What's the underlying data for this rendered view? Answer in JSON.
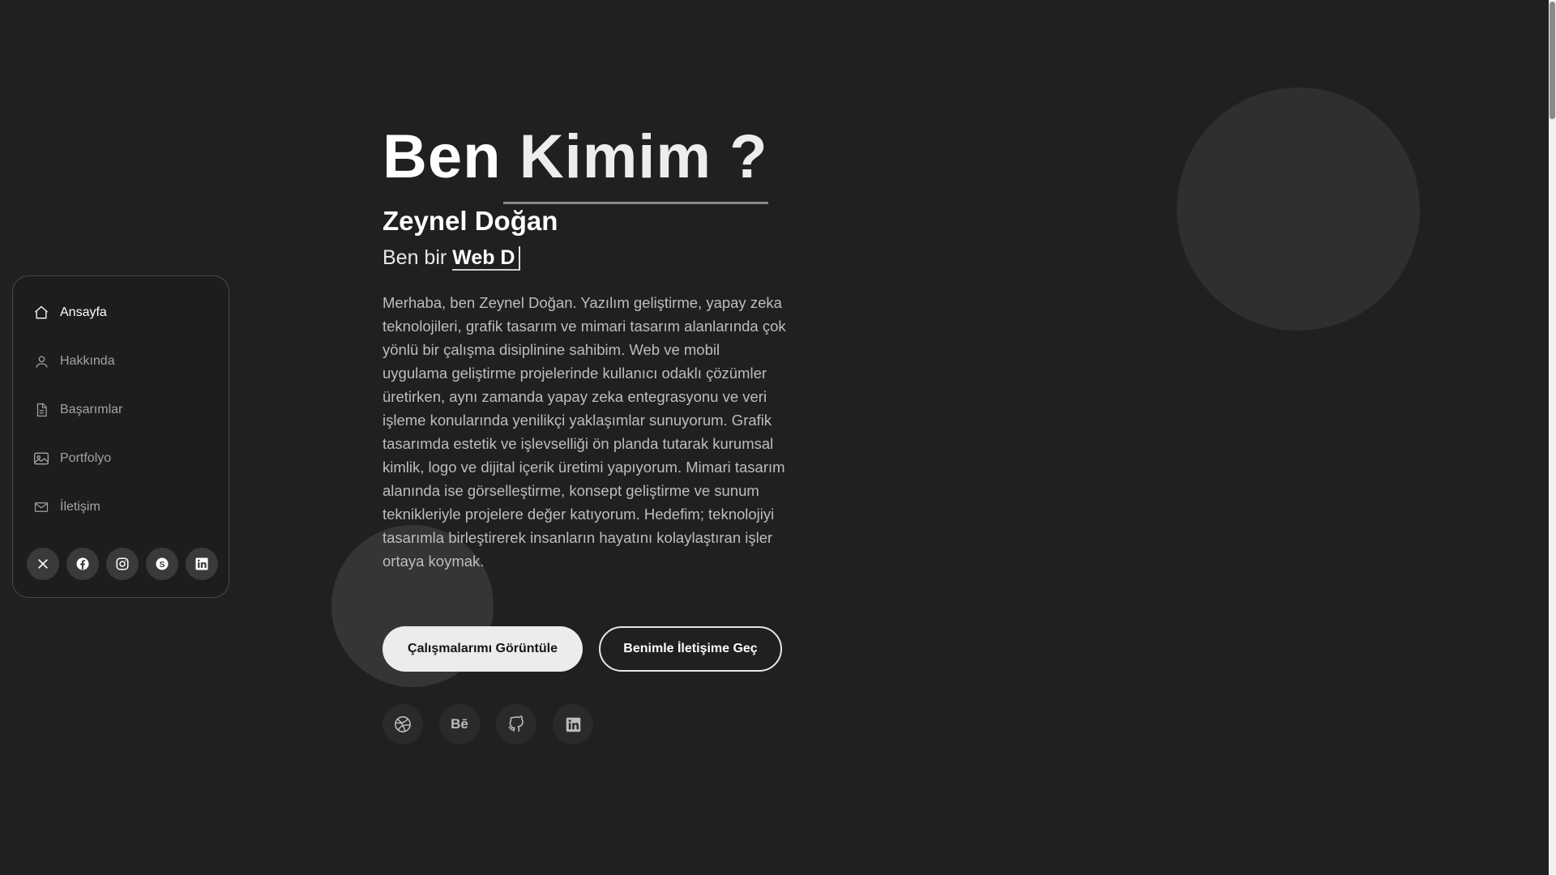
{
  "sidebar": {
    "items": [
      {
        "label": "Ansayfa",
        "icon": "home-icon",
        "active": true
      },
      {
        "label": "Hakkında",
        "icon": "user-icon"
      },
      {
        "label": "Başarımlar",
        "icon": "document-icon"
      },
      {
        "label": "Portfolyo",
        "icon": "images-icon"
      },
      {
        "label": "İletişim",
        "icon": "mail-icon"
      }
    ],
    "socials": [
      "x-icon",
      "facebook-icon",
      "instagram-icon",
      "skype-icon",
      "linkedin-icon"
    ]
  },
  "hero": {
    "title_a": "Ben",
    "title_b": "Kimim ?",
    "name": "Zeynel Doğan",
    "role_prefix": "Ben bir",
    "role_typed": "Web D",
    "description": "Merhaba, ben Zeynel Doğan. Yazılım geliştirme, yapay zeka teknolojileri, grafik tasarım ve mimari tasarım alanlarında çok yönlü bir çalışma disiplinine sahibim. Web ve mobil uygulama geliştirme projelerinde kullanıcı odaklı çözümler üretirken, aynı zamanda yapay zeka entegrasyonu ve veri işleme konularında yenilikçi yaklaşımlar sunuyorum. Grafik tasarımda estetik ve işlevselliği ön planda tutarak kurumsal kimlik, logo ve dijital içerik üretimi yapıyorum. Mimari tasarım alanında ise görselleştirme, konsept geliştirme ve sunum teknikleriyle projelere değer katıyorum. Hedefim; teknolojiyi tasarımla birleştirerek insanların hayatını kolaylaştıran işler ortaya koymak.",
    "primary_button": "Çalışmalarımı Görüntüle",
    "secondary_button": "Benimle İletişime Geç",
    "socials": [
      "dribbble-icon",
      "behance-icon",
      "github-icon",
      "linkedin-icon"
    ],
    "behance_text": "Bē"
  },
  "colors": {
    "background": "#202020",
    "text": "#ffffff",
    "muted": "#a3a3a3",
    "button": "#ececec"
  }
}
